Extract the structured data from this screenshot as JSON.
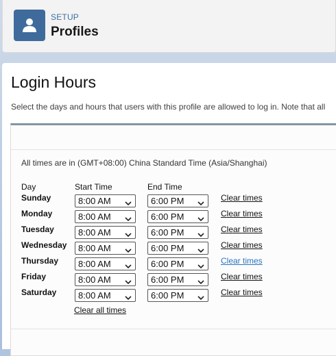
{
  "header": {
    "eyebrow": "SETUP",
    "title": "Profiles",
    "icon": "user-icon"
  },
  "page": {
    "title": "Login Hours",
    "description": "Select the days and hours that users with this profile are allowed to log in. Note that all"
  },
  "timezone_note": "All times are in (GMT+08:00) China Standard Time (Asia/Shanghai)",
  "columns": {
    "day": "Day",
    "start": "Start Time",
    "end": "End Time"
  },
  "clear_times_label": "Clear times",
  "clear_all_label": "Clear all times",
  "rows": [
    {
      "day": "Sunday",
      "start": "8:00 AM",
      "end": "6:00 PM",
      "clear": "Clear times"
    },
    {
      "day": "Monday",
      "start": "8:00 AM",
      "end": "6:00 PM",
      "clear": "Clear times"
    },
    {
      "day": "Tuesday",
      "start": "8:00 AM",
      "end": "6:00 PM",
      "clear": "Clear times"
    },
    {
      "day": "Wednesday",
      "start": "8:00 AM",
      "end": "6:00 PM",
      "clear": "Clear times"
    },
    {
      "day": "Thursday",
      "start": "8:00 AM",
      "end": "6:00 PM",
      "clear": "Clear times"
    },
    {
      "day": "Friday",
      "start": "8:00 AM",
      "end": "6:00 PM",
      "clear": "Clear times"
    },
    {
      "day": "Saturday",
      "start": "8:00 AM",
      "end": "6:00 PM",
      "clear": "Clear times"
    }
  ],
  "colors": {
    "accent": "#3f6b9c",
    "link_hover": "#2a73c0"
  }
}
